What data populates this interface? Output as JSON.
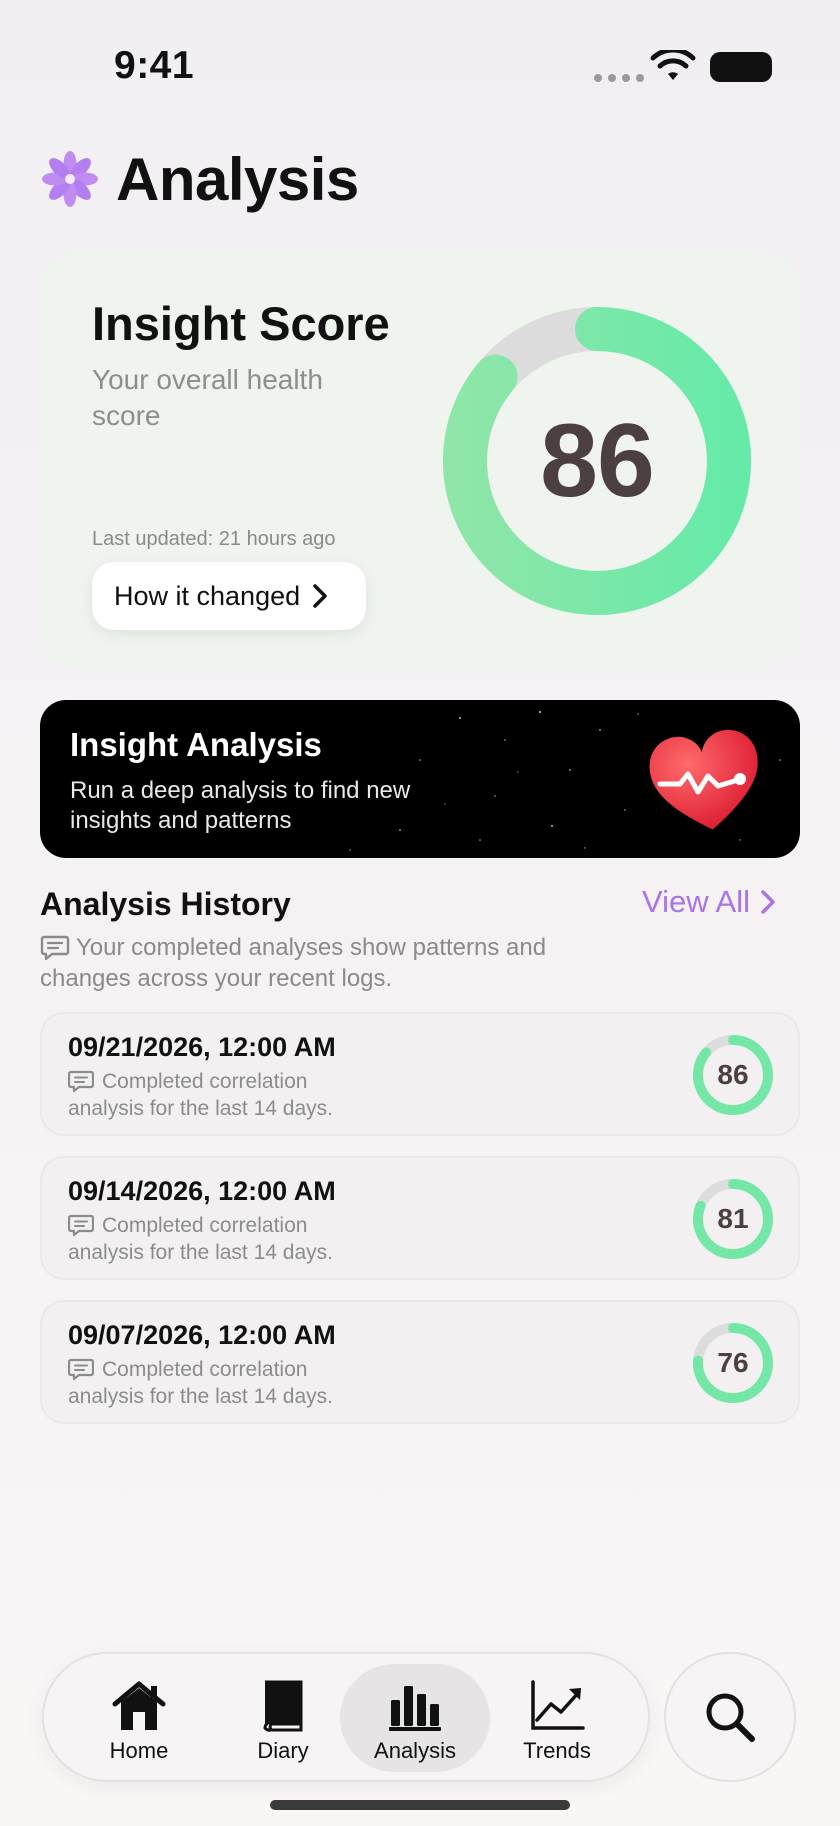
{
  "status_bar": {
    "time": "9:41"
  },
  "header": {
    "title": "Analysis",
    "logo_icon": "flower-icon"
  },
  "insight_score": {
    "title": "Insight Score",
    "subtitle": "Your overall health score",
    "score": "86",
    "score_fraction": 0.86,
    "last_updated": "Last updated: 21 hours ago",
    "button_label": "How it changed"
  },
  "insight_analysis": {
    "title": "Insight Analysis",
    "description": "Run a deep analysis to find new insights and patterns",
    "icon": "heart-icon"
  },
  "history": {
    "title": "Analysis History",
    "view_all": "View All",
    "description": "Your completed analyses show patterns and changes across your recent logs.",
    "items": [
      {
        "date": "09/21/2026, 12:00 AM",
        "description": "Completed correlation analysis for the last 14 days.",
        "score": "86",
        "fraction": 0.86
      },
      {
        "date": "09/14/2026, 12:00 AM",
        "description": "Completed correlation analysis for the last 14 days.",
        "score": "81",
        "fraction": 0.81
      },
      {
        "date": "09/07/2026, 12:00 AM",
        "description": "Completed correlation analysis for the last 14 days.",
        "score": "76",
        "fraction": 0.76
      }
    ]
  },
  "tab_bar": {
    "tabs": [
      {
        "label": "Home",
        "icon": "home-icon"
      },
      {
        "label": "Diary",
        "icon": "book-icon"
      },
      {
        "label": "Analysis",
        "icon": "bar-chart-icon",
        "active": true
      },
      {
        "label": "Trends",
        "icon": "trend-chart-icon"
      }
    ],
    "search_icon": "search-icon"
  },
  "colors": {
    "accent": "#a874e6",
    "ring_green": "#6ee6a4",
    "ring_track": "#dcdcdc",
    "score_text": "#4b3f3f"
  }
}
